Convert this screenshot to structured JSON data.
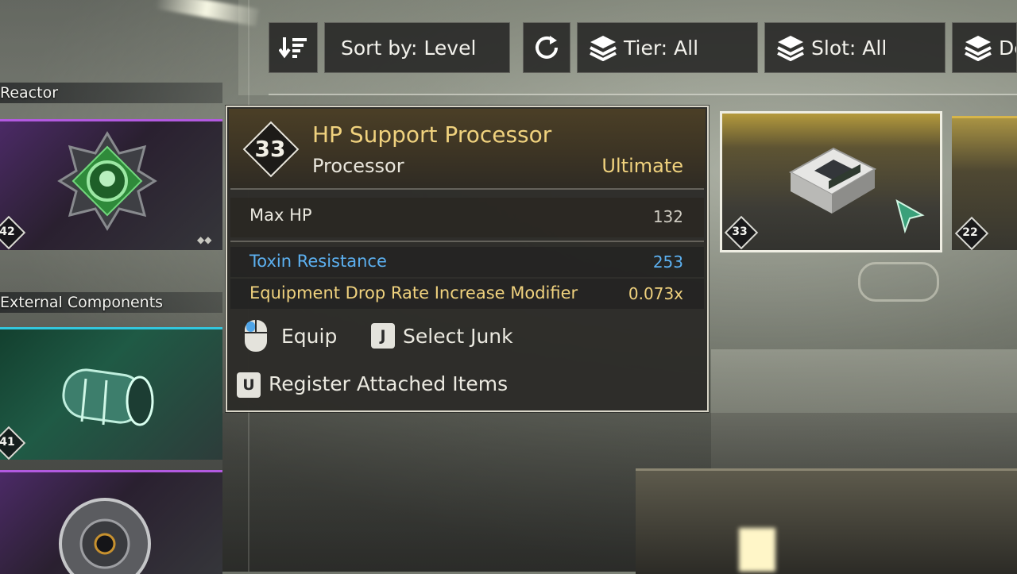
{
  "toolbar": {
    "sort_label": "Sort by: Level",
    "tier_label": "Tier: All",
    "slot_label": "Slot: All",
    "extra_label": "De"
  },
  "sidebar": {
    "categories": [
      {
        "label": "Reactor",
        "level": "42"
      },
      {
        "label": "External Components",
        "level": "41"
      }
    ]
  },
  "grid": {
    "items": [
      {
        "level": "33"
      },
      {
        "level": "22"
      }
    ]
  },
  "tooltip": {
    "level": "33",
    "name": "HP Support Processor",
    "type": "Processor",
    "rarity": "Ultimate",
    "stats": [
      {
        "name": "Max HP",
        "value": "132",
        "color": "#ebe9e0"
      },
      {
        "name": "Toxin Resistance",
        "value": "253",
        "color": "#5cb0f0"
      },
      {
        "name": "Equipment Drop Rate Increase Modifier",
        "value": "0.073x",
        "color": "#f0d27e"
      }
    ],
    "actions": {
      "equip_label": "Equip",
      "junk_key": "J",
      "junk_label": "Select Junk",
      "register_key": "U",
      "register_label": "Register Attached Items"
    }
  },
  "colors": {
    "accent_gold": "#f0d27e",
    "accent_blue": "#5cb0f0",
    "purple_tier": "#b25ae0",
    "cyan_tier": "#33c6dd"
  }
}
